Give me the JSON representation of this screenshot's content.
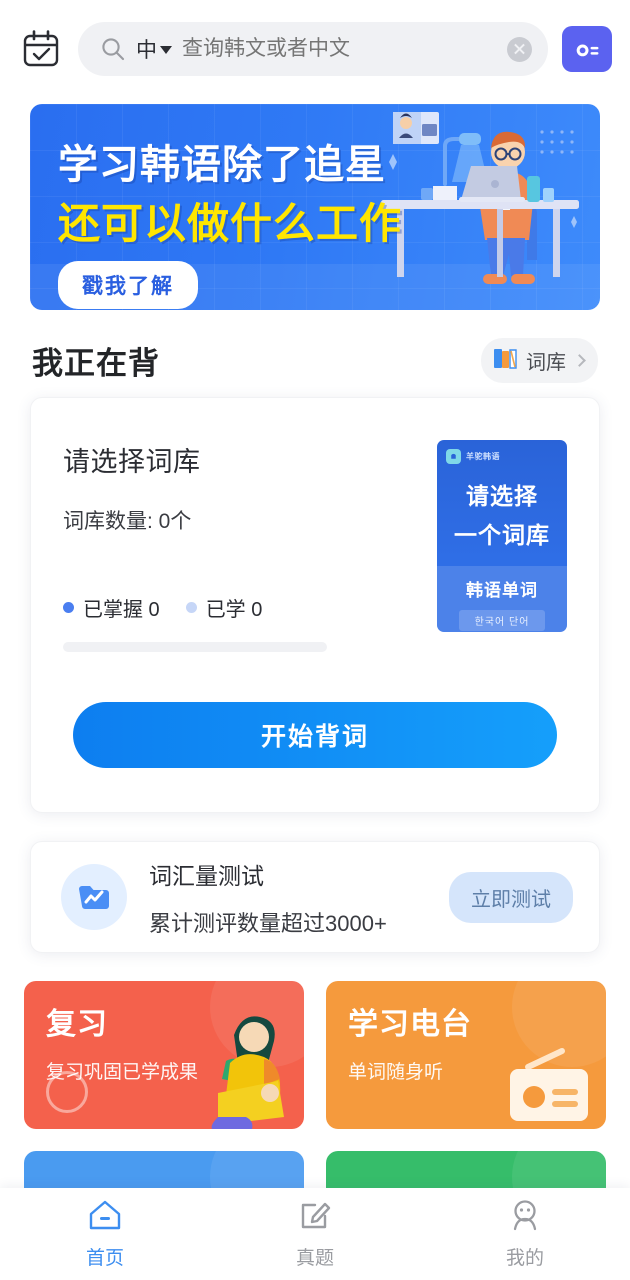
{
  "topbar": {
    "calendar_icon": "calendar-check-icon",
    "search": {
      "icon": "search-icon",
      "language": "中",
      "placeholder": "查询韩文或者中文",
      "value": "",
      "clear_icon": "clear-circle-icon"
    },
    "radio_button_icon": "radio-card-icon",
    "radio_button_color": "#5b62f0"
  },
  "banner": {
    "line1": "学习韩语除了追星",
    "line2": "还可以做什么工作",
    "cta": "戳我了解",
    "bg_color": "#2f79f5",
    "line1_color": "#ffffff",
    "line2_color": "#ffe600",
    "art": "man-at-desk-with-laptop-illustration"
  },
  "section": {
    "title": "我正在背",
    "library_chip": {
      "icon": "books-icon",
      "label": "词库",
      "chevron": "chevron-right-icon"
    }
  },
  "main_card": {
    "title": "请选择词库",
    "count_line": "词库数量: 0个",
    "legend": [
      {
        "label": "已掌握 0",
        "color": "#4a7ef0"
      },
      {
        "label": "已学 0",
        "color": "#c6d6f7"
      }
    ],
    "progress_percent": 0,
    "progress_track_color": "#f0f1f4",
    "thumbnail": {
      "brand": "羊驼韩语",
      "line1": "请选择",
      "line2": "一个词库",
      "subtitle": "韩语单词",
      "korean": "한국어 단어",
      "bg_color": "#2f6ee6"
    },
    "start_button": "开始背词",
    "start_button_color": "#159ffb"
  },
  "test_card": {
    "icon": "chart-folder-icon",
    "title": "词汇量测试",
    "subtitle": "累计测评数量超过3000+",
    "button": "立即测试",
    "button_bg": "#d5e5fb"
  },
  "tiles": [
    {
      "title": "复习",
      "subtitle": "复习巩固已学成果",
      "color": "#f4614c",
      "art": "person-holding-books-illustration",
      "cut_off": false
    },
    {
      "title": "学习电台",
      "subtitle": "单词随身听",
      "color": "#f59a3d",
      "art": "radio-icon",
      "cut_off": false
    },
    {
      "title": "",
      "subtitle": "",
      "color": "#4a9bf0",
      "art": "",
      "cut_off": true
    },
    {
      "title": "",
      "subtitle": "",
      "color": "#36bd6a",
      "art": "",
      "cut_off": true
    }
  ],
  "navbar": {
    "items": [
      {
        "label": "首页",
        "icon": "home-icon",
        "active": true
      },
      {
        "label": "真题",
        "icon": "edit-paper-icon",
        "active": false
      },
      {
        "label": "我的",
        "icon": "person-icon",
        "active": false
      }
    ],
    "active_color": "#3d8ef0",
    "inactive_color": "#9a9ca1"
  }
}
